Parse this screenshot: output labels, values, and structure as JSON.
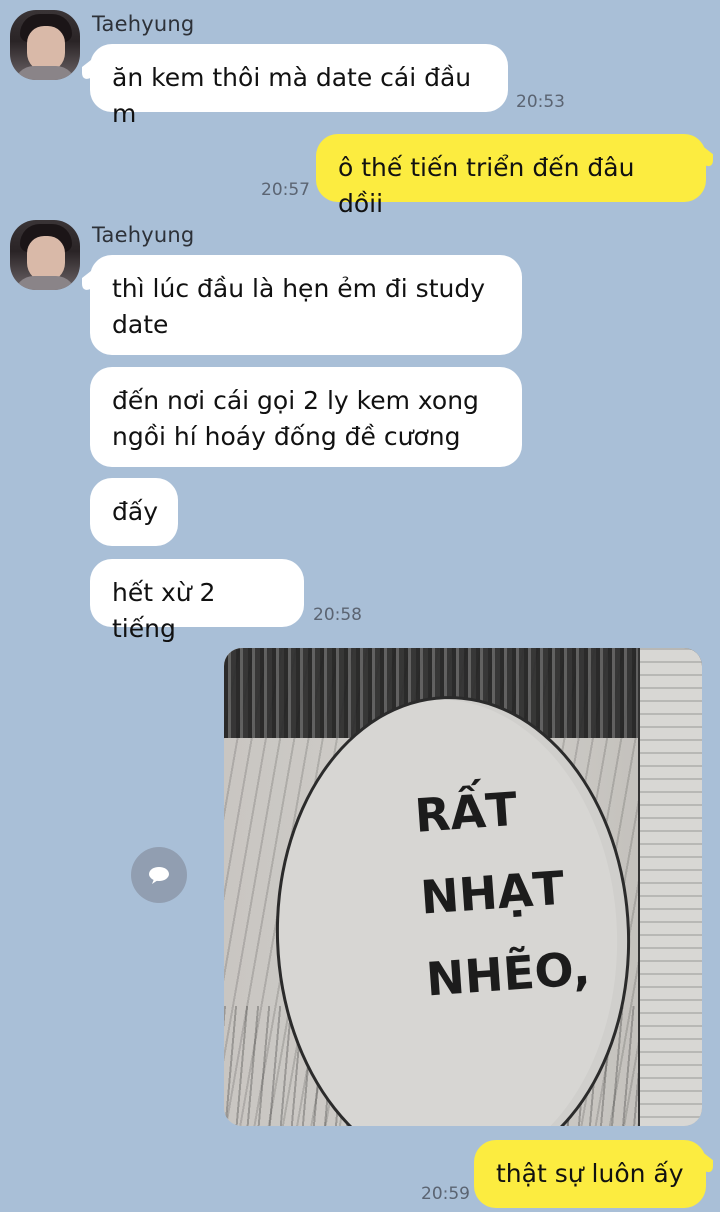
{
  "conversation": {
    "groups": [
      {
        "sender": "Taehyung",
        "messages": [
          {
            "text": "ăn kem thôi mà date cái đầu m",
            "time": "20:53"
          }
        ]
      },
      {
        "sender": "Me",
        "messages": [
          {
            "text": "ô thế tiến triển đến đâu dồii",
            "time": "20:57"
          }
        ]
      },
      {
        "sender": "Taehyung",
        "messages": [
          {
            "text": "thì lúc đầu là hẹn ẻm đi study\ndate"
          },
          {
            "text": "đến nơi cái gọi 2 ly kem xong\nngồi hí hoáy đống đề cương"
          },
          {
            "text": "đấy"
          },
          {
            "text": "hết xừ 2 tiếng",
            "time": "20:58"
          }
        ]
      },
      {
        "sender": "Me",
        "image_message": {
          "caption": "RẤT\nNHẠT\nNHẼO,"
        },
        "messages": [
          {
            "text": "thật sự luôn ấy",
            "time": "20:59"
          }
        ]
      }
    ]
  },
  "icons": {
    "avatar": "profile-photo",
    "share": "speech-bubble-icon"
  },
  "colors": {
    "background": "#a9bfd7",
    "incoming_bubble": "#ffffff",
    "outgoing_bubble": "#fcec40",
    "timestamp": "#5b6472"
  }
}
